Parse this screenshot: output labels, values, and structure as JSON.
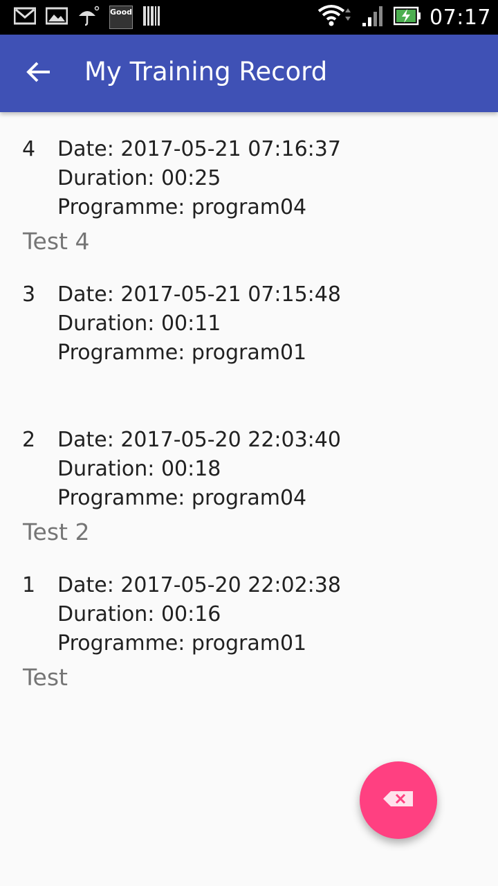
{
  "status_bar": {
    "time": "07:17",
    "icons": [
      "gmail-icon",
      "image-icon",
      "umbrella-icon",
      "good-app-icon",
      "barcode-icon",
      "wifi-icon",
      "signal-icon",
      "battery-charging-icon"
    ],
    "good_label": "Good"
  },
  "app_bar": {
    "title": "My Training Record",
    "back_icon": "arrow-back-icon"
  },
  "records": [
    {
      "index": "4",
      "date": "Date: 2017-05-21 07:16:37",
      "duration": "Duration: 00:25",
      "programme": "Programme: program04",
      "note": "Test 4"
    },
    {
      "index": "3",
      "date": "Date: 2017-05-21 07:15:48",
      "duration": "Duration: 00:11",
      "programme": "Programme: program01",
      "note": ""
    },
    {
      "index": "2",
      "date": "Date: 2017-05-20 22:03:40",
      "duration": "Duration: 00:18",
      "programme": "Programme: program04",
      "note": "Test 2"
    },
    {
      "index": "1",
      "date": "Date: 2017-05-20 22:02:38",
      "duration": "Duration: 00:16",
      "programme": "Programme: program01",
      "note": "Test"
    }
  ],
  "fab": {
    "icon": "backspace-icon"
  },
  "colors": {
    "primary": "#3f51b5",
    "accent": "#ff4081",
    "background": "#fafafa"
  }
}
